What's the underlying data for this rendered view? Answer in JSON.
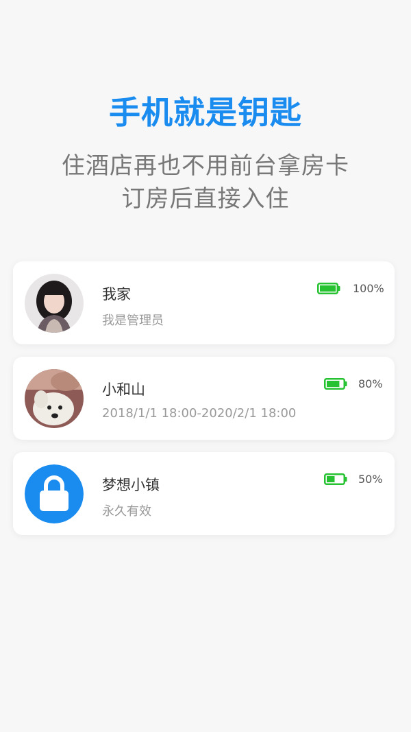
{
  "hero": {
    "title": "手机就是钥匙",
    "subtitle_line1": "住酒店再也不用前台拿房卡",
    "subtitle_line2": "订房后直接入住"
  },
  "colors": {
    "accent": "#1a8cf0",
    "battery": "#27c232",
    "lock_avatar": "#1a8cf0"
  },
  "cards": [
    {
      "name": "我家",
      "subtitle": "我是管理员",
      "battery_text": "100%",
      "battery_level": 1.0,
      "avatar": "photo-avatar-woman"
    },
    {
      "name": "小和山",
      "subtitle": "2018/1/1 18:00-2020/2/1 18:00",
      "battery_text": "80%",
      "battery_level": 0.8,
      "avatar": "photo-avatar-dog"
    },
    {
      "name": "梦想小镇",
      "subtitle": "永久有效",
      "battery_text": "50%",
      "battery_level": 0.5,
      "avatar": "lock-icon"
    }
  ]
}
